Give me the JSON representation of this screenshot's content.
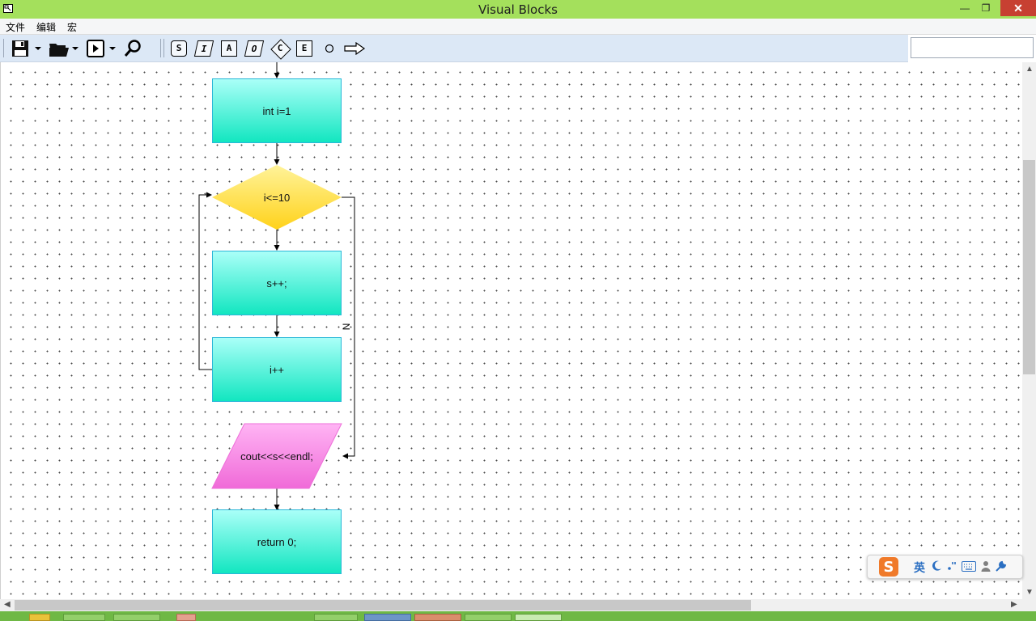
{
  "window": {
    "title": "Visual Blocks",
    "minimize_glyph": "—",
    "restore_glyph": "❐",
    "close_glyph": "✕"
  },
  "menu": [
    "文件",
    "编辑",
    "宏"
  ],
  "toolbar": {
    "symbol_buttons": [
      "S",
      "I",
      "A",
      "O",
      "C",
      "E"
    ]
  },
  "flowchart": {
    "nodes": {
      "init": "int i=1",
      "condition": "i<=10",
      "body": "s++;",
      "increment": "i++",
      "output": "cout<<s<<endl;",
      "return": "return 0;"
    },
    "branch_label": "N"
  },
  "ime": {
    "logo": "S",
    "mode": "英"
  },
  "colors": {
    "titlebar": "#a4e05c",
    "close_button": "#c74032",
    "process_top": "#aafff8",
    "process_bottom": "#12e6c0",
    "decision": "#ffd92e",
    "io": "#f27fe0"
  }
}
